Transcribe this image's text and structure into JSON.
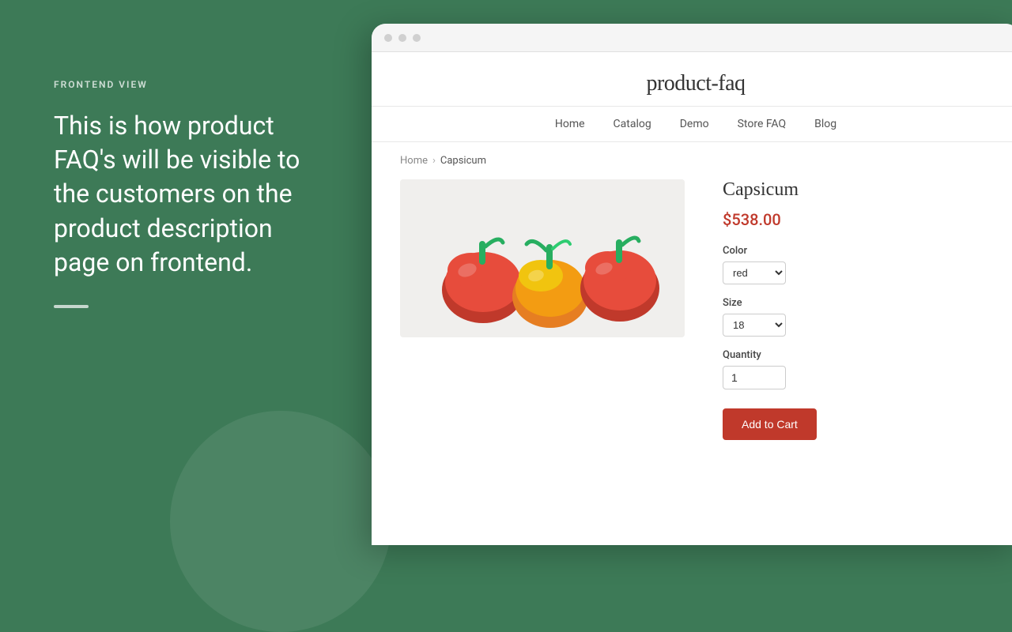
{
  "left": {
    "frontend_label": "FRONTEND VIEW",
    "description": "This is how product FAQ's will be visible to the customers on the product description page on frontend."
  },
  "store": {
    "title": "product-faq",
    "nav": [
      "Home",
      "Catalog",
      "Demo",
      "Store FAQ",
      "Blog"
    ],
    "breadcrumb": {
      "home": "Home",
      "separator": "›",
      "current": "Capsicum"
    },
    "product": {
      "name": "Capsicum",
      "price": "$538.00",
      "color_label": "Color",
      "color_value": "red",
      "size_label": "Size",
      "size_value": "18",
      "quantity_label": "Quantity",
      "quantity_value": "1",
      "add_to_cart": "Add to Cart"
    }
  }
}
